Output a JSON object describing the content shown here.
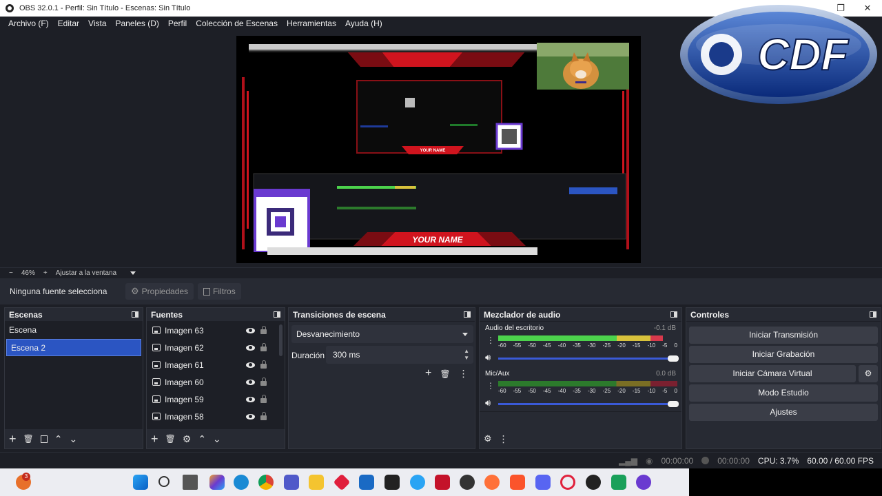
{
  "window": {
    "title": "OBS 32.0.1 - Perfil: Sin Título - Escenas: Sin Título",
    "maximize_glyph": "❐",
    "close_glyph": "✕"
  },
  "menu": [
    "Archivo (F)",
    "Editar",
    "Vista",
    "Paneles (D)",
    "Perfil",
    "Colección de Escenas",
    "Herramientas",
    "Ayuda (H)"
  ],
  "logo_text": "CDF",
  "preview": {
    "texts": {
      "your_name": "YOUR NAME",
      "your_name_small": "YOUR NAME"
    },
    "colors": {
      "accent_red": "#d0141e",
      "qr_purple": "#6a3ad0"
    }
  },
  "zoom": {
    "minus": "−",
    "value": "46%",
    "plus": "+",
    "fit_label": "Ajustar a la ventana"
  },
  "source_toolbar": {
    "no_selection": "Ninguna fuente selecciona",
    "properties": "Propiedades",
    "filters": "Filtros"
  },
  "scenes": {
    "title": "Escenas",
    "items": [
      {
        "label": "Escena",
        "selected": false
      },
      {
        "label": "Escena 2",
        "selected": true
      }
    ]
  },
  "sources": {
    "title": "Fuentes",
    "items": [
      "Imagen 63",
      "Imagen 62",
      "Imagen 61",
      "Imagen 60",
      "Imagen 59",
      "Imagen 58"
    ]
  },
  "transitions": {
    "title": "Transiciones de escena",
    "selected": "Desvanecimiento",
    "duration_label": "Duración",
    "duration_value": "300 ms"
  },
  "mixer": {
    "title": "Mezclador de audio",
    "channels": [
      {
        "name": "Audio del escritorio",
        "db": "-0.1 dB",
        "level": 0.92,
        "muted": false
      },
      {
        "name": "Mic/Aux",
        "db": "0.0 dB",
        "level": 0.0,
        "muted": false
      }
    ],
    "ticks": [
      "-60",
      "-55",
      "-50",
      "-45",
      "-40",
      "-35",
      "-30",
      "-25",
      "-20",
      "-15",
      "-10",
      "-5",
      "0"
    ],
    "colors": {
      "green": "#4cd24c",
      "yellow": "#d8c23c",
      "red": "#d8394c",
      "green_dim": "#2c7a2c",
      "yellow_dim": "#7a6e24",
      "red_dim": "#7a2030"
    }
  },
  "controls": {
    "title": "Controles",
    "buttons": [
      "Iniciar Transmisión",
      "Iniciar Grabación",
      "Iniciar Cámara Virtual",
      "Modo Estudio",
      "Ajustes"
    ]
  },
  "status": {
    "stream_time": "00:00:00",
    "rec_time": "00:00:00",
    "cpu": "CPU: 3.7%",
    "fps": "60.00 / 60.00 FPS"
  },
  "taskbar": {
    "badge_count": "3"
  }
}
